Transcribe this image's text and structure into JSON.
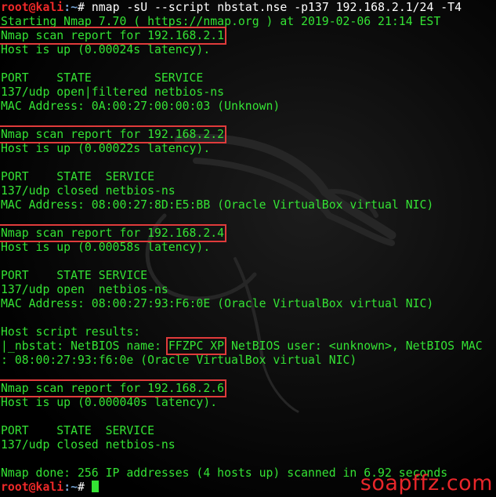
{
  "terminal": {
    "prompt_user": "root@kali",
    "prompt_path": ":~",
    "prompt_symbol": "#",
    "command": " nmap -sU --script nbstat.nse -p137 192.168.2.1/24 -T4",
    "starting": "Starting Nmap 7.70 ( https://nmap.org ) at 2019-02-06 21:14 EST",
    "hosts": [
      {
        "report": "Nmap scan report for 192.168.2.1",
        "status": "Host is up (0.00024s latency).",
        "header": "PORT    STATE         SERVICE",
        "port": "137/udp open|filtered netbios-ns",
        "mac": "MAC Address: 0A:00:27:00:00:03 (Unknown)"
      },
      {
        "report": "Nmap scan report for 192.168.2.2",
        "status": "Host is up (0.00022s latency).",
        "header": "PORT    STATE  SERVICE",
        "port": "137/udp closed netbios-ns",
        "mac": "MAC Address: 08:00:27:8D:E5:BB (Oracle VirtualBox virtual NIC)"
      },
      {
        "report": "Nmap scan report for 192.168.2.4",
        "status": "Host is up (0.00058s latency).",
        "header": "PORT    STATE SERVICE",
        "port": "137/udp open  netbios-ns",
        "mac": "MAC Address: 08:00:27:93:F6:0E (Oracle VirtualBox virtual NIC)",
        "script_results": "Host script results:",
        "nbstat_prefix": "|_nbstat: NetBIOS name: ",
        "netbios_name": "FFZPC XP",
        "nbstat_suffix": " NetBIOS user: <unknown>, NetBIOS MAC",
        "nbstat_cont": ": 08:00:27:93:f6:0e (Oracle VirtualBox virtual NIC)"
      },
      {
        "report": "Nmap scan report for 192.168.2.6",
        "status": "Host is up (0.000040s latency).",
        "header": "PORT    STATE  SERVICE",
        "port": "137/udp closed netbios-ns"
      }
    ],
    "done": "Nmap done: 256 IP addresses (4 hosts up) scanned in 6.92 seconds"
  },
  "watermark": "soapffz.com",
  "colors": {
    "text": "#34e234",
    "prompt_user": "#ef2929",
    "prompt_path": "#729fcf",
    "highlight_box": "#e03b3b",
    "watermark": "#e8262a"
  },
  "icons": [
    "kali-dragon-logo"
  ]
}
